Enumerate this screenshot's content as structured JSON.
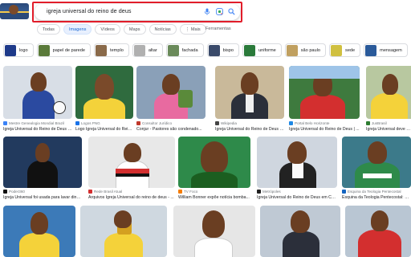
{
  "search": {
    "query": "igreja universal do reino de deus"
  },
  "icons": {
    "mic": "microphone-icon",
    "lens": "google-lens-icon",
    "search": "search-icon"
  },
  "tabs": [
    {
      "label": "Todas",
      "active": false
    },
    {
      "label": "Imagens",
      "active": true
    },
    {
      "label": "Vídeos",
      "active": false
    },
    {
      "label": "Maps",
      "active": false
    },
    {
      "label": "Notícias",
      "active": false
    },
    {
      "label": "⋮ Mais",
      "active": false
    }
  ],
  "tools_label": "Ferramentas",
  "chips": [
    {
      "label": "logo",
      "color": "#1e3a8a"
    },
    {
      "label": "papel de parede",
      "color": "#5a7a3a"
    },
    {
      "label": "templo",
      "color": "#8a6a4a"
    },
    {
      "label": "altar",
      "color": "#b0b0b0"
    },
    {
      "label": "fachada",
      "color": "#6a8a5a"
    },
    {
      "label": "bispo",
      "color": "#3a4a6a"
    },
    {
      "label": "uniforme",
      "color": "#2a7a3a"
    },
    {
      "label": "são paulo",
      "color": "#c0a060"
    },
    {
      "label": "sede",
      "color": "#d0c040"
    },
    {
      "label": "mensagem",
      "color": "#2a5a9a"
    }
  ],
  "results_row1": [
    {
      "source": "Mestre Genealogia Mondial Brazil",
      "caption": "Igreja Universal do Reino de Deus | M...",
      "fav": "#3b82f6"
    },
    {
      "source": "Logos PNG",
      "caption": "Logo Igreja Universal do Reino de...",
      "fav": "#1a73e8"
    },
    {
      "source": "Consultor Jurídico",
      "caption": "Conjur - Pastores são condenado...",
      "fav": "#c0392b"
    },
    {
      "source": "Wikipedia",
      "caption": "Igreja Universal do Reino de Deus - ...",
      "fav": "#444444"
    },
    {
      "source": "Portal Belo Horizonte",
      "caption": "Igreja Universal do Reino de Deus | ...",
      "fav": "#1e88e5"
    },
    {
      "source": "JusBrasil",
      "caption": "Igreja Universal deve de...",
      "fav": "#2e7d32"
    }
  ],
  "results_row2": [
    {
      "source": "Poder360",
      "caption": "Igreja Universal foi usada para lavar dinhei...",
      "fav": "#111111"
    },
    {
      "source": "Rede Brasil Atual",
      "caption": "Arquivos Igreja Universal do reino de deus - ...",
      "fav": "#d32f2f"
    },
    {
      "source": "TV Foco",
      "caption": "William Bonner expõe notícia bomba...",
      "fav": "#f57c00"
    },
    {
      "source": "Metrópoles",
      "caption": "Igreja Universal do Reino de Deus em CA...",
      "fav": "#212121"
    },
    {
      "source": "Esquina da Teologia Pentecostal",
      "caption": "Esquina da Teologia Pentecostal: Bispo ...",
      "fav": "#1565c0"
    }
  ]
}
